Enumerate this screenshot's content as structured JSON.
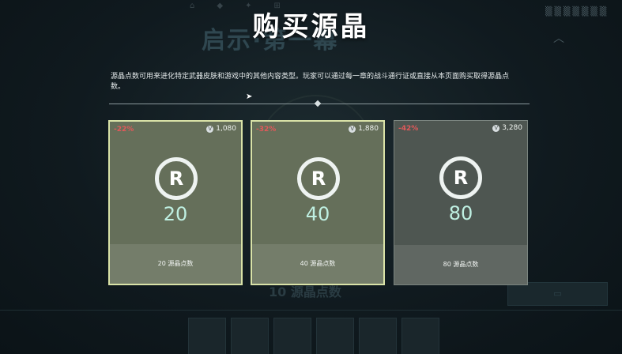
{
  "background": {
    "title": "启示·第一幕",
    "bottom_label": "10 源晶点数"
  },
  "modal": {
    "title": "购买源晶",
    "description": "源晶点数可用来进化特定武器皮肤和游戏中的其他内容类型。玩家可以通过每一章的战斗通行证或直接从本页面购买取得源晶点数。"
  },
  "colors": {
    "discount": "#e2595a",
    "selected_border": "#d9e2a7",
    "amount_text": "#bff0e2"
  },
  "packages": [
    {
      "discount": "-22%",
      "price": "1,080",
      "amount": "20",
      "label": "20 源晶点数",
      "selected": true
    },
    {
      "discount": "-32%",
      "price": "1,880",
      "amount": "40",
      "label": "40 源晶点数",
      "selected": true
    },
    {
      "discount": "-42%",
      "price": "3,280",
      "amount": "80",
      "label": "80 源晶点数",
      "selected": false
    }
  ],
  "icons": {
    "currency": "vp-icon",
    "package": "radianite-icon"
  }
}
